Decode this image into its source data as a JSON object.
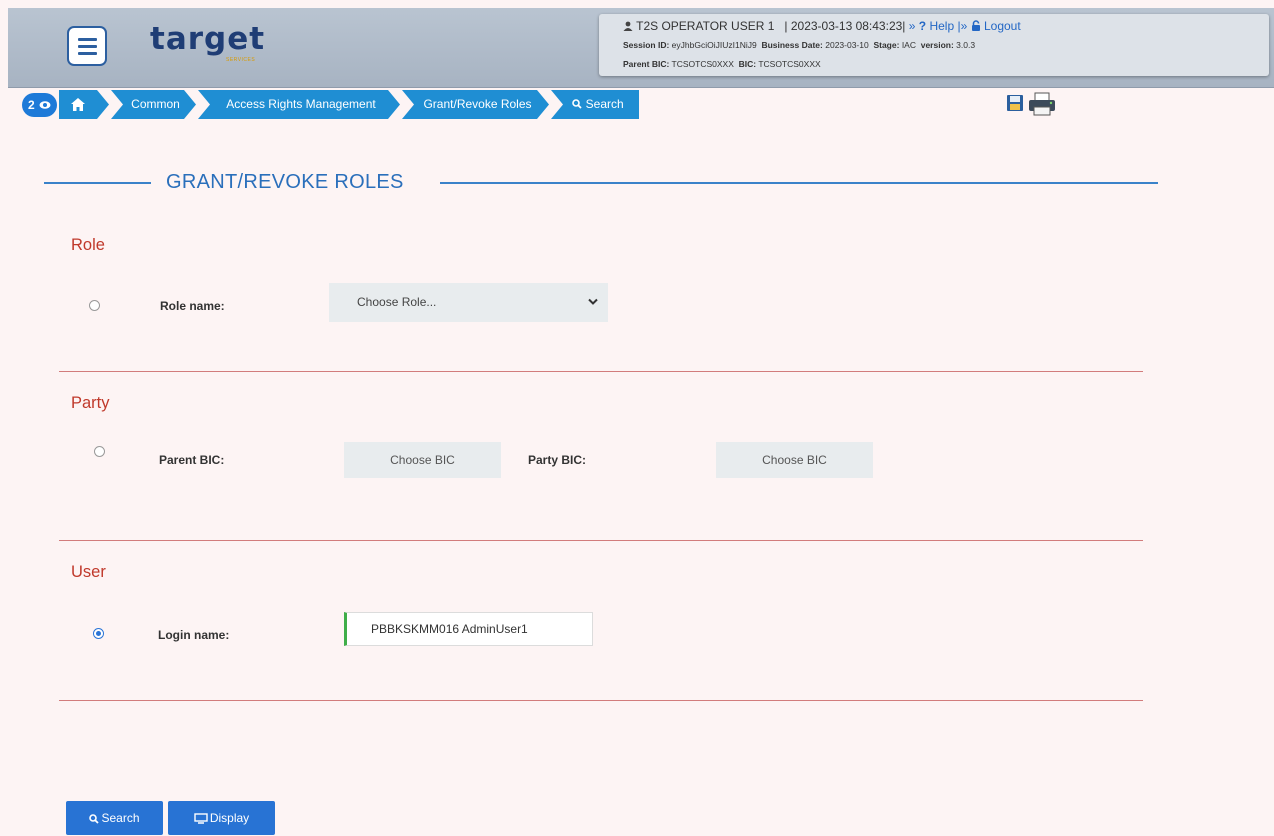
{
  "header": {
    "logo_text": "target",
    "logo_sub": "SERVICES",
    "user_name": "T2S OPERATOR USER 1",
    "datetime_text": "| 2023-03-13 08:43:23|",
    "help_sep": "»",
    "help_q": "?",
    "help_label": "Help",
    "logout_sep": "|»",
    "logout_label": "Logout",
    "session_label": "Session ID:",
    "session_value": "eyJhbGciOiJIUzI1NiJ9",
    "business_date_label": "Business Date:",
    "business_date_value": "2023-03-10",
    "stage_label": "Stage:",
    "stage_value": "IAC",
    "version_label": "version:",
    "version_value": "3.0.3",
    "parent_bic_label": "Parent BIC:",
    "parent_bic_value": "TCSOTCS0XXX",
    "bic_label": "BIC:",
    "bic_value": "TCSOTCS0XXX"
  },
  "breadcrumb": {
    "badge_count": "2",
    "items": [
      "Common",
      "Access Rights Management",
      "Grant/Revoke Roles",
      "Search"
    ]
  },
  "page": {
    "title": "GRANT/REVOKE ROLES"
  },
  "role_section": {
    "title": "Role",
    "field_label": "Role name:",
    "select_value": "Choose Role...",
    "selected": false
  },
  "party_section": {
    "title": "Party",
    "parent_bic_label": "Parent BIC:",
    "parent_bic_button": "Choose BIC",
    "party_bic_label": "Party BIC:",
    "party_bic_button": "Choose BIC",
    "selected": false
  },
  "user_section": {
    "title": "User",
    "field_label": "Login name:",
    "login_value": "PBBKSKMM016 AdminUser1",
    "selected": true
  },
  "actions": {
    "search_label": "Search",
    "display_label": "Display"
  },
  "colors": {
    "accent": "#1f8ed3",
    "button": "#2873d4",
    "section_title": "#c0392b",
    "valid_border": "#3fae49"
  }
}
